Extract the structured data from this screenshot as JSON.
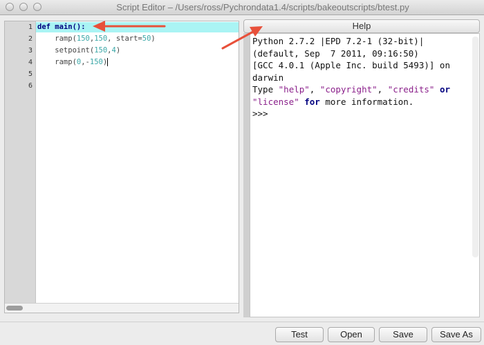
{
  "window": {
    "title": "Script Editor – /Users/ross/Pychrondata1.4/scripts/bakeoutscripts/btest.py"
  },
  "editor": {
    "line_numbers": [
      "1",
      "2",
      "3",
      "4",
      "5",
      "6"
    ],
    "lines": [
      {
        "kw": "def",
        "fn": "main",
        "rest": "():"
      },
      {
        "prefix": "    ramp(",
        "n1": "150",
        "sep1": ",",
        "n2": "150",
        "mid": ", start=",
        "n3": "50",
        "end": ")"
      },
      {
        "prefix": "    setpoint(",
        "n1": "150",
        "sep1": ",",
        "n2": "4",
        "end": ")"
      },
      {
        "prefix": "    ramp(",
        "n1": "0",
        "sep1": ",-",
        "n2": "150",
        "end": ")"
      }
    ]
  },
  "help": {
    "label": "Help"
  },
  "console": {
    "line1": "Python 2.7.2 |EPD 7.2-1 (32-bit)| (default, Sep  7 2011, 09:16:50)",
    "line2": "[GCC 4.0.1 (Apple Inc. build 5493)] on darwin",
    "type_word": "Type ",
    "s_help": "\"help\"",
    "comma1": ", ",
    "s_copyright": "\"copyright\"",
    "comma2": ", ",
    "s_credits": "\"credits\"",
    "or_word": " or ",
    "s_license": "\"license\"",
    "for_word": " for",
    "tail": " more information.",
    "prompt": ">>>"
  },
  "buttons": {
    "test": "Test",
    "open": "Open",
    "save": "Save",
    "save_as": "Save As"
  },
  "colors": {
    "annotation_arrow": "#e8503a",
    "line_highlight": "#aaf4f4",
    "keyword": "#00007f",
    "number": "#3aa7a7",
    "string": "#8a1f8a"
  }
}
